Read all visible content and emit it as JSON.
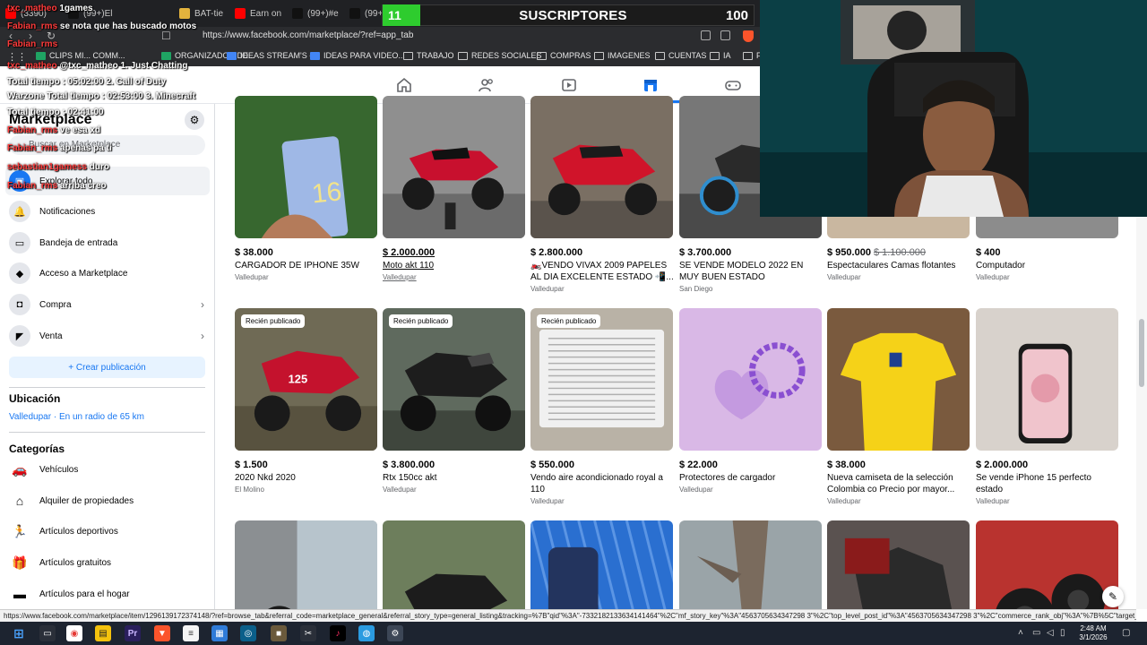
{
  "browser": {
    "tabs": [
      {
        "label": "(3390)",
        "color": "#ff0000"
      },
      {
        "label": "(99+)El",
        "color": "#111111"
      },
      {
        "label": "BAT-tie",
        "color": "#e3b33d"
      },
      {
        "label": "Earn on",
        "color": "#ff0000"
      },
      {
        "label": "(99+)#e",
        "color": "#111111"
      },
      {
        "label": "(99+)Ún",
        "color": "#111111"
      },
      {
        "label": "(6) Insta",
        "color": "#d62976"
      },
      {
        "label": "(99+)#p",
        "color": "#111111"
      },
      {
        "label": "Captura",
        "color": "#7b4cc9"
      }
    ],
    "url": "https://www.facebook.com/marketplace/?ref=app_tab",
    "bookmarks": [
      {
        "label": "CLIPS MI... COMM...",
        "kind": "sheet"
      },
      {
        "label": "ORGANIZADOR DE...",
        "kind": "sheet"
      },
      {
        "label": "IDEAS STREAM'S -...",
        "kind": "doc"
      },
      {
        "label": "IDEAS PARA VIDEO...",
        "kind": "doc"
      },
      {
        "label": "TRABAJO",
        "kind": "folder"
      },
      {
        "label": "REDES SOCIALES",
        "kind": "folder"
      },
      {
        "label": "COMPRAS",
        "kind": "folder"
      },
      {
        "label": "IMAGENES",
        "kind": "folder"
      },
      {
        "label": "CUENTAS",
        "kind": "folder"
      },
      {
        "label": "IA",
        "kind": "folder"
      },
      {
        "label": "F",
        "kind": "folder"
      }
    ]
  },
  "subscriber_widget": {
    "count": "11",
    "label": "SUSCRIPTORES",
    "goal": "100",
    "progress_fraction": 0.11
  },
  "chat": [
    {
      "name": "txc_matheo",
      "text": "1games"
    },
    {
      "name": "Fabian_rms",
      "text": "se nota que has buscado motos"
    },
    {
      "name": "Fabian_rms",
      "text": ""
    },
    {
      "name": "txc_matheo",
      "text": "@txc_matheo 1. Just Chatting"
    },
    {
      "name": "",
      "text": "Total tiempo : 05:02:00 2. Call of Duty"
    },
    {
      "name": "",
      "text": "Warzone Total tiempo : 02:53:00 3. Minecraft"
    },
    {
      "name": "",
      "text": "Total tiempo : 02:41:00"
    },
    {
      "name": "Fabian_rms",
      "text": "ve esa xd"
    },
    {
      "name": "Fabian_rms",
      "text": "apenas pa ti"
    },
    {
      "name": "sebastian1gamess",
      "text": "duro"
    },
    {
      "name": "Fabian_rms",
      "text": "arriba creo"
    }
  ],
  "sidebar": {
    "title": "Marketplace",
    "search_placeholder": "Buscar en Marketplace",
    "items": [
      {
        "label": "Explorar todo",
        "icon": "store-icon",
        "active": true
      },
      {
        "label": "Notificaciones",
        "icon": "bell-icon"
      },
      {
        "label": "Bandeja de entrada",
        "icon": "inbox-icon"
      },
      {
        "label": "Acceso a Marketplace",
        "icon": "shield-icon"
      },
      {
        "label": "Compra",
        "icon": "bag-icon",
        "chevron": true
      },
      {
        "label": "Venta",
        "icon": "tag-icon",
        "chevron": true
      }
    ],
    "create_label": "+ Crear publicación",
    "location_heading": "Ubicación",
    "location_value": "Valledupar · En un radio de 65 km",
    "categories_heading": "Categorías",
    "categories": [
      {
        "label": "Vehículos",
        "icon": "car-icon"
      },
      {
        "label": "Alquiler de propiedades",
        "icon": "house-icon"
      },
      {
        "label": "Artículos deportivos",
        "icon": "runner-icon"
      },
      {
        "label": "Artículos gratuitos",
        "icon": "gift-icon"
      },
      {
        "label": "Artículos para el hogar",
        "icon": "sofa-icon"
      }
    ]
  },
  "listings": [
    {
      "price": "$ 38.000",
      "title": "CARGADOR DE IPHONE 35W",
      "location": "Valledupar",
      "badge": "",
      "img": "phone-box"
    },
    {
      "price": "$ 2.000.000",
      "title": "Moto akt 110",
      "location": "Valledupar",
      "badge": "",
      "img": "moto-red",
      "hover": true
    },
    {
      "price": "$ 2.800.000",
      "title": "🏍️VENDO VIVAX 2009 PAPELES AL DIA EXCELENTE ESTADO 📲...",
      "location": "Valledupar",
      "badge": "",
      "img": "moto-red2"
    },
    {
      "price": "$ 3.700.000",
      "title": "SE VENDE MODELO 2022 EN MUY BUEN ESTADO",
      "location": "San Diego",
      "badge": "",
      "img": "moto-blue"
    },
    {
      "price": "$ 950.000",
      "old_price": "$ 1.100.000",
      "title": "Espectaculares Camas flotantes",
      "location": "Valledupar",
      "badge": "",
      "img": "bed"
    },
    {
      "price": "$ 400",
      "title": "Computador",
      "location": "Valledupar",
      "badge": "",
      "img": "pc"
    },
    {
      "price": "$ 1.500",
      "title": "2020 Nkd 2020",
      "location": "El Molino",
      "badge": "Recién publicado",
      "img": "moto-nkd"
    },
    {
      "price": "$ 3.800.000",
      "title": "Rtx 150cc akt",
      "location": "Valledupar",
      "badge": "Recién publicado",
      "img": "moto-dark"
    },
    {
      "price": "$ 550.000",
      "title": "Vendo aire acondicionado royal a 110",
      "location": "Valledupar",
      "badge": "Recién publicado",
      "img": "ac"
    },
    {
      "price": "$ 22.000",
      "title": "Protectores de cargador",
      "location": "Valledupar",
      "badge": "",
      "img": "protector"
    },
    {
      "price": "$ 38.000",
      "title": "Nueva camiseta de la selección Colombia co Precio por mayor...",
      "location": "Valledupar",
      "badge": "",
      "img": "shirt"
    },
    {
      "price": "$ 2.000.000",
      "title": "Se vende iPhone 15 perfecto estado",
      "location": "Valledupar",
      "badge": "",
      "img": "iphone"
    },
    {
      "price": "",
      "title": "",
      "location": "",
      "badge": "",
      "img": "moto-row3a"
    },
    {
      "price": "",
      "title": "",
      "location": "",
      "badge": "",
      "img": "moto-row3b"
    },
    {
      "price": "",
      "title": "",
      "location": "",
      "badge": "",
      "img": "phone-blue"
    },
    {
      "price": "",
      "title": "",
      "location": "",
      "badge": "",
      "img": "tree-moto"
    },
    {
      "price": "",
      "title": "",
      "location": "",
      "badge": "",
      "img": "moto-row3e"
    },
    {
      "price": "",
      "title": "",
      "location": "",
      "badge": "",
      "img": "speakers"
    }
  ],
  "status_url": "https://www.facebook.com/marketplace/item/1296139172374148/?ref=browse_tab&referral_code=marketplace_general&referral_story_type=general_listing&tracking=%7B\"qid\"%3A\"-7332182133634141464\"%2C\"mf_story_key\"%3A\"4563705634347298 3\"%2C\"top_level_post_id\"%3A\"4563705634347298 3\"%2C\"commerce_rank_obj\"%3A\"%7B%5C\"target_...",
  "taskbar": {
    "time": "2:48 AM",
    "date": "3/1/2026"
  }
}
